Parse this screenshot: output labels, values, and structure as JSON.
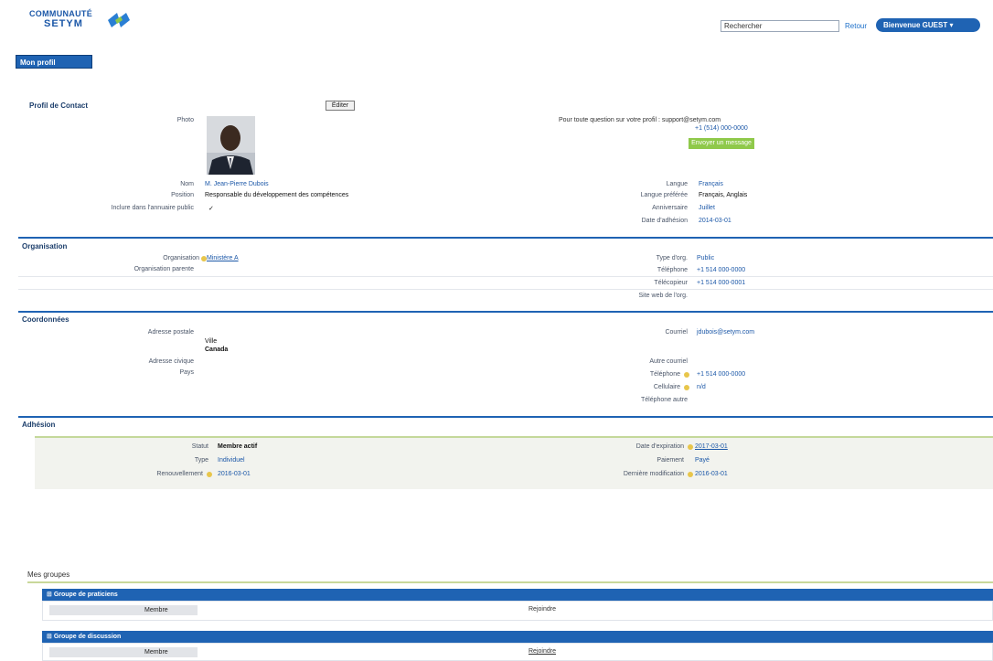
{
  "header": {
    "logo_line1": "COMMUNAUTÉ",
    "logo_line2": "SETYM",
    "search_value": "Rechercher",
    "search_link": "Retour",
    "user_pill": "Bienvenue GUEST ▾"
  },
  "my_button": "Mon profil",
  "profile": {
    "title": "Profil de Contact",
    "edit_label": "Éditer",
    "photo_label": "Photo",
    "contact_line": "Pour toute question sur votre profil : support@setym.com",
    "phone": "+1 (514) 000-0000",
    "green_button": "Envoyer un message",
    "rows_left": [
      {
        "label": "Nom",
        "value": "M. Jean-Pierre Dubois"
      },
      {
        "label": "Position",
        "value": "Responsable du développement des compétences"
      },
      {
        "label": "Inclure dans l'annuaire public",
        "value": "✓"
      }
    ],
    "rows_right": [
      {
        "label": "Langue",
        "value": "Français"
      },
      {
        "label": "Langue préférée",
        "value": "Français, Anglais"
      },
      {
        "label": "Anniversaire",
        "value": "Juillet"
      },
      {
        "label": "Date d'adhésion",
        "value": "2014-03-01"
      }
    ]
  },
  "org": {
    "title": "Organisation",
    "rows_left": [
      {
        "label": "Organisation",
        "value": "Ministère A"
      },
      {
        "label": "Organisation parente",
        "value": ""
      }
    ],
    "rows_right": [
      {
        "label": "Type d'org.",
        "value": "Public"
      },
      {
        "label": "Téléphone",
        "value": "+1 514 000-0000"
      },
      {
        "label": "Télécopieur",
        "value": "+1 514 000-0001"
      },
      {
        "label": "Site web de l'org.",
        "value": ""
      }
    ]
  },
  "coords": {
    "title": "Coordonnées",
    "address_label": "Adresse postale",
    "address_lines": [
      "Ville",
      "Canada"
    ],
    "addr2_label": "Adresse civique",
    "addr3_label": "Pays",
    "email_label": "Courriel",
    "email_value": "jdubois@setym.com",
    "alt_email_label": "Autre courriel",
    "phone_label": "Téléphone",
    "phone_value": "+1 514 000-0000",
    "cell_label": "Cellulaire",
    "cell_value": "n/d",
    "other_label": "Téléphone autre"
  },
  "membership": {
    "title": "Adhésion",
    "rows_left": [
      {
        "label": "Statut",
        "value": "Membre actif"
      },
      {
        "label": "Type",
        "value": "Individuel"
      },
      {
        "label": "Renouvellement",
        "value": "2016-03-01"
      }
    ],
    "rows_right": [
      {
        "label": "Date d'expiration",
        "value": "2017-03-01"
      },
      {
        "label": "Paiement",
        "value": "Payé"
      },
      {
        "label": "Dernière modification",
        "value": "2016-03-01"
      }
    ]
  },
  "groups": {
    "title": "Mes groupes",
    "items": [
      {
        "title": "Groupe de praticiens",
        "col1": "Membre",
        "col2": "Rejoindre"
      },
      {
        "title": "Groupe de discussion",
        "col1": "Membre",
        "col2": "Rejoindre"
      }
    ]
  },
  "colors": {
    "primary": "#1f63b3",
    "accent_green": "#8fc94a",
    "link": "#1c58a8"
  }
}
